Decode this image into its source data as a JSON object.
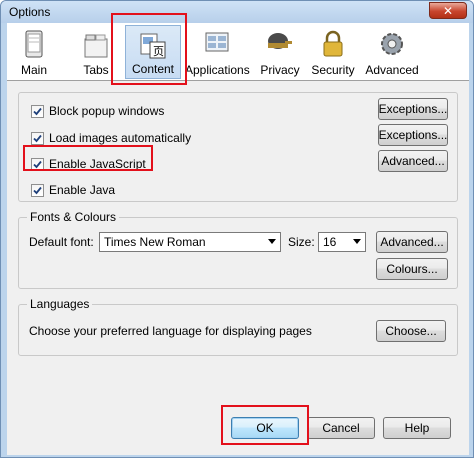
{
  "window": {
    "title": "Options",
    "close_glyph": "✕"
  },
  "toolbar": {
    "items": [
      {
        "label": "Main",
        "icon": "main-window-icon"
      },
      {
        "label": "Tabs",
        "icon": "tabs-icon"
      },
      {
        "label": "Content",
        "icon": "content-icon",
        "selected": true
      },
      {
        "label": "Applications",
        "icon": "applications-icon"
      },
      {
        "label": "Privacy",
        "icon": "privacy-mask-icon"
      },
      {
        "label": "Security",
        "icon": "padlock-icon"
      },
      {
        "label": "Advanced",
        "icon": "gear-icon"
      }
    ]
  },
  "content": {
    "block_popups": {
      "label": "Block popup windows",
      "checked": true
    },
    "load_images": {
      "label": "Load images automatically",
      "checked": true
    },
    "enable_js": {
      "label": "Enable JavaScript",
      "checked": true
    },
    "enable_java": {
      "label": "Enable Java",
      "checked": true
    },
    "exceptions_label": "Exceptions...",
    "advanced_label": "Advanced..."
  },
  "fonts": {
    "group_title": "Fonts & Colours",
    "default_font_label": "Default font:",
    "default_font_value": "Times New Roman",
    "size_label": "Size:",
    "size_value": "16",
    "advanced_label": "Advanced...",
    "colours_label": "Colours..."
  },
  "languages": {
    "group_title": "Languages",
    "description": "Choose your preferred language for displaying pages",
    "choose_label": "Choose..."
  },
  "footer": {
    "ok_label": "OK",
    "cancel_label": "Cancel",
    "help_label": "Help"
  },
  "colors": {
    "highlight": "#e3101b",
    "accent_blue": "#3c7fb1"
  }
}
